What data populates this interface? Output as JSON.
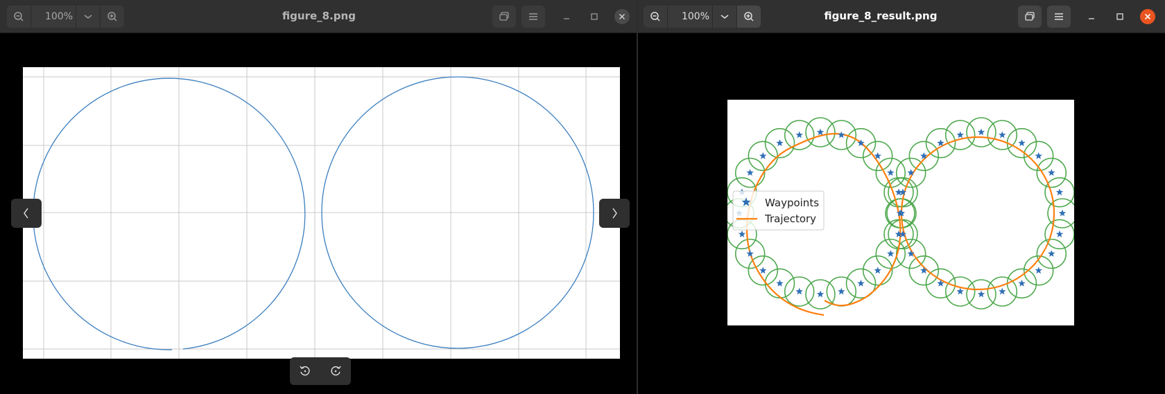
{
  "left_window": {
    "zoom_level": "100%",
    "title": "figure_8.png",
    "figure": {
      "grid": true,
      "curve_color": "#3a7ebf"
    }
  },
  "right_window": {
    "zoom_level": "100%",
    "title": "figure_8_result.png",
    "figure": {
      "legend": [
        "Waypoints",
        "Trajectory"
      ],
      "colors": {
        "waypoints": "#2f6fb5",
        "trajectory": "#ff7f0e",
        "circles": "#2f9a2f"
      }
    }
  },
  "icons": {
    "zoom_out": "zoom-out-icon",
    "zoom_in": "zoom-in-icon",
    "dropdown": "chevron-down-icon",
    "gallery": "gallery-icon",
    "menu": "hamburger-menu-icon",
    "minimize": "minimize-icon",
    "maximize": "maximize-icon",
    "close": "close-icon",
    "prev": "chevron-left-icon",
    "next": "chevron-right-icon",
    "rotate_left": "rotate-left-icon",
    "rotate_right": "rotate-right-icon"
  },
  "colors": {
    "close_active": "#e95420",
    "title_active": "#ffffff",
    "title_inactive": "#b5b5b5"
  }
}
